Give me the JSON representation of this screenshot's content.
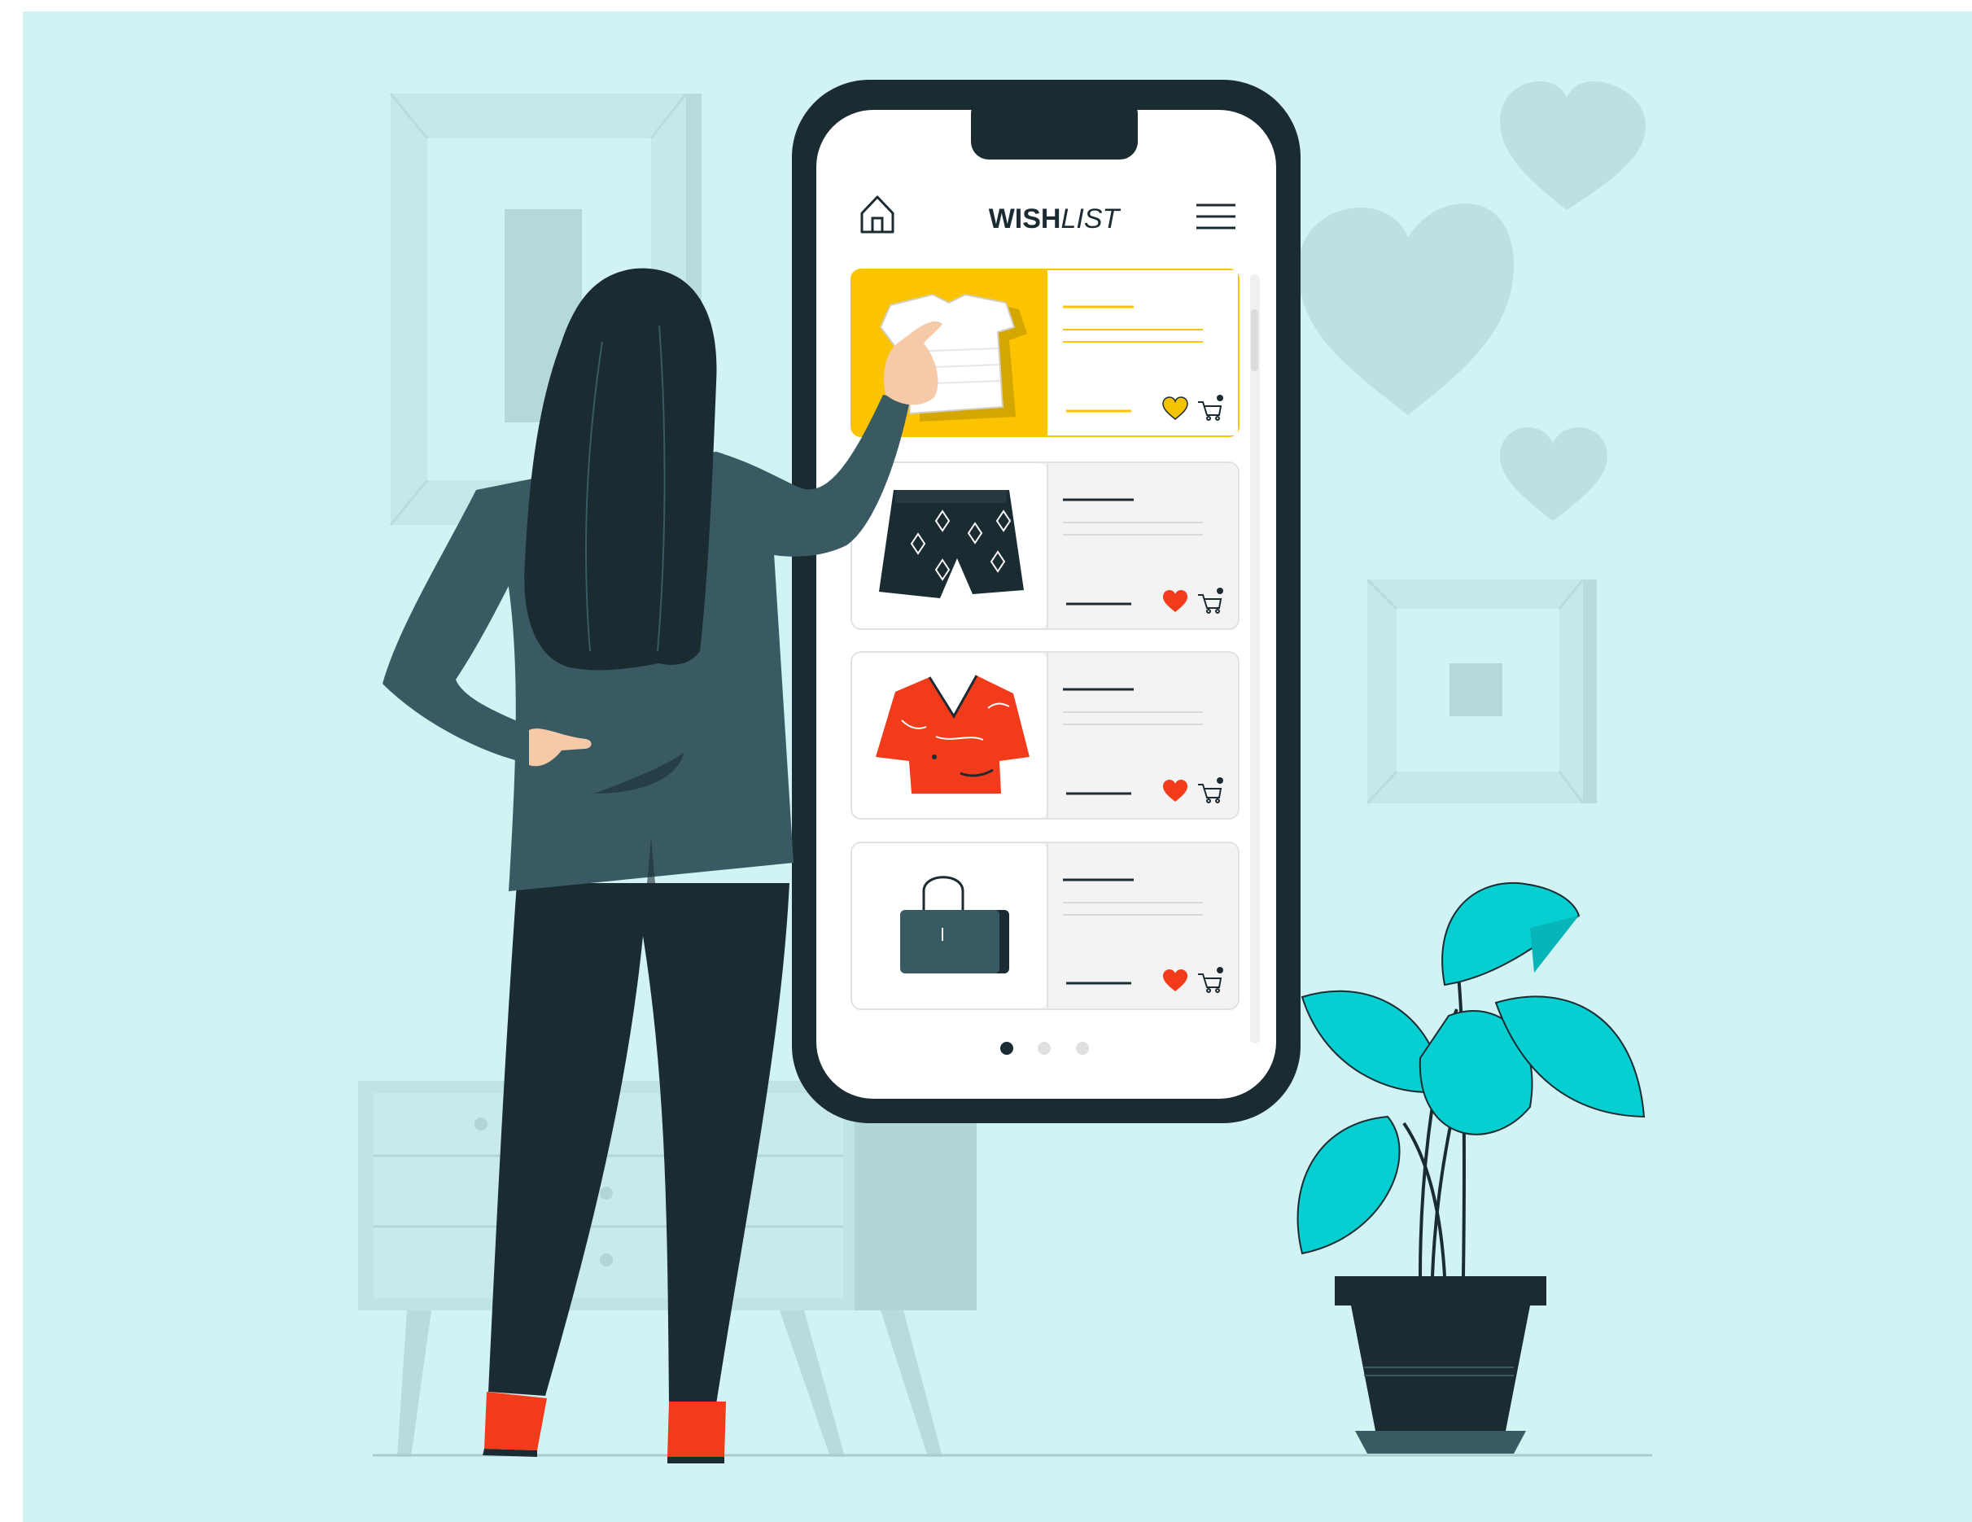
{
  "app": {
    "title_strong": "WISH",
    "title_light": "LIST",
    "home_icon": "home-icon",
    "menu_icon": "hamburger-menu-icon"
  },
  "wishlist": {
    "items": [
      {
        "product": "t-shirt",
        "selected": true,
        "favorite_color": "#f5c400",
        "icons": [
          "heart-icon",
          "cart-icon"
        ]
      },
      {
        "product": "patterned-shorts",
        "selected": false,
        "favorite_color": "#f23b1a",
        "icons": [
          "heart-icon",
          "cart-icon"
        ]
      },
      {
        "product": "red-blouse",
        "selected": false,
        "favorite_color": "#f23b1a",
        "icons": [
          "heart-icon",
          "cart-icon"
        ]
      },
      {
        "product": "handbag",
        "selected": false,
        "favorite_color": "#f23b1a",
        "icons": [
          "heart-icon",
          "cart-icon"
        ]
      }
    ]
  },
  "pagination": {
    "pages": 3,
    "current": 1
  },
  "colors": {
    "background": "#d2f3f3",
    "phone_frame": "#1b2b32",
    "accent_yellow": "#fcc300",
    "accent_red": "#f23b1a",
    "jacket": "#395a62",
    "plant": "#06cfd2"
  }
}
